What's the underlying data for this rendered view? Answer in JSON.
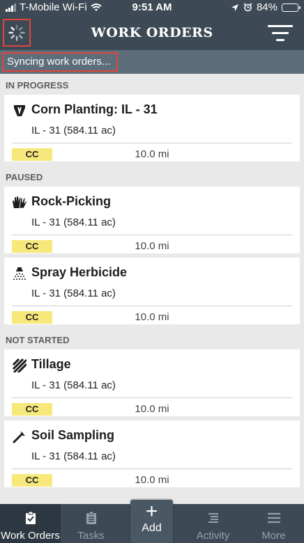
{
  "status_bar": {
    "carrier": "T-Mobile Wi-Fi",
    "time": "9:51 AM",
    "battery": "84%",
    "battery_level": 0.84
  },
  "header": {
    "title": "WORK ORDERS"
  },
  "sync": {
    "message": "Syncing work orders..."
  },
  "sections": [
    {
      "title": "IN PROGRESS",
      "cards": [
        {
          "title": "Corn Planting: IL - 31",
          "field": "IL - 31 (584.11 ac)",
          "badge": "CC",
          "distance": "10.0 mi",
          "icon": "seed-planter-icon"
        }
      ]
    },
    {
      "title": "PAUSED",
      "cards": [
        {
          "title": "Rock-Picking",
          "field": "IL - 31 (584.11 ac)",
          "badge": "CC",
          "distance": "10.0 mi",
          "icon": "gloves-icon"
        },
        {
          "title": "Spray Herbicide",
          "field": "IL - 31 (584.11 ac)",
          "badge": "CC",
          "distance": "10.0 mi",
          "icon": "sprayer-icon"
        }
      ]
    },
    {
      "title": "NOT STARTED",
      "cards": [
        {
          "title": "Tillage",
          "field": "IL - 31 (584.11 ac)",
          "badge": "CC",
          "distance": "10.0 mi",
          "icon": "tillage-icon"
        },
        {
          "title": "Soil Sampling",
          "field": "IL - 31 (584.11 ac)",
          "badge": "CC",
          "distance": "10.0 mi",
          "icon": "soil-probe-icon"
        }
      ]
    }
  ],
  "tabs": {
    "work_orders": "Work Orders",
    "tasks": "Tasks",
    "add": "Add",
    "activity": "Activity",
    "more": "More"
  },
  "colors": {
    "header_bg": "#3d4a55",
    "highlight_border": "#e0443a",
    "badge_bg": "#f6e87a"
  }
}
